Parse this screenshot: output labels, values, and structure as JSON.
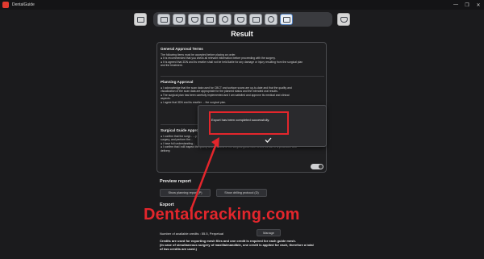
{
  "window": {
    "title": "DentalGuide",
    "controls": [
      "—",
      "❐",
      "✕"
    ]
  },
  "toolbar": {
    "left_icon": "patient-icon",
    "tools": [
      "ct-scan-icon",
      "model-icon",
      "crown-icon",
      "nerve-icon",
      "tooth-icon",
      "implant-icon",
      "sleeve-icon",
      "guide-icon",
      "report-icon"
    ],
    "active_tool": "report-icon",
    "right_icon": "export-icon"
  },
  "main": {
    "heading": "Result",
    "general": {
      "title": "General Approval Terms",
      "lines": [
        "The following items must be accepted before placing an order.",
        "● It is recommended that you check all relevant information before proceeding with the surgery.",
        "● It is agreed that 3DN and its reseller shall not be held liable for any damage or injury resulting from the surgical plan",
        "and the treatment."
      ]
    },
    "planning": {
      "title": "Planning Approval",
      "lines": [
        "● I acknowledge that the scan data used for CBCT and surface scans are up-to-date and that the quality and",
        "visualization of the scan data are appropriate for the planned status and the intended oral results.",
        "● The surgical plan has been carefully implemented and I am satisfied and approve its medical and clinical",
        "aspects.",
        "● I agree that 3DN and its reseller ... the surgical plan."
      ]
    },
    "surgical": {
      "title": "Surgical Guide Appro...",
      "lines": [
        "● I confirm that the surgi...                                              ...y placed during the",
        "surgery, and perform the...",
        "● I have full understanding...",
        "● I confirm that I will inspect the quality and functions of the surgical guide both before its use in a procedure and",
        "delivery."
      ]
    },
    "dialog": {
      "message": "Export has been completed successfully.",
      "ok": "✓"
    },
    "preview": {
      "title": "Preview report",
      "planning_btn": "Show planning report (P)",
      "drilling_btn": "Show drilling protocol (D)"
    },
    "export": {
      "title": "Export",
      "credits_label": "Number of available credits : 55.5,  Perpetual",
      "manage_btn": "Manage",
      "note_1": "Credits are used for exporting mesh files and one credit is required for each guide mesh.",
      "note_2": "(In case of simultaneous surgery of maxilla/mandible, one credit is applied for each, therefore a total",
      "note_3": "of two credits are used.)"
    }
  },
  "watermark": "Dentalcracking.com",
  "colors": {
    "accent_red": "#e3262c",
    "background": "#1b1b1d"
  }
}
